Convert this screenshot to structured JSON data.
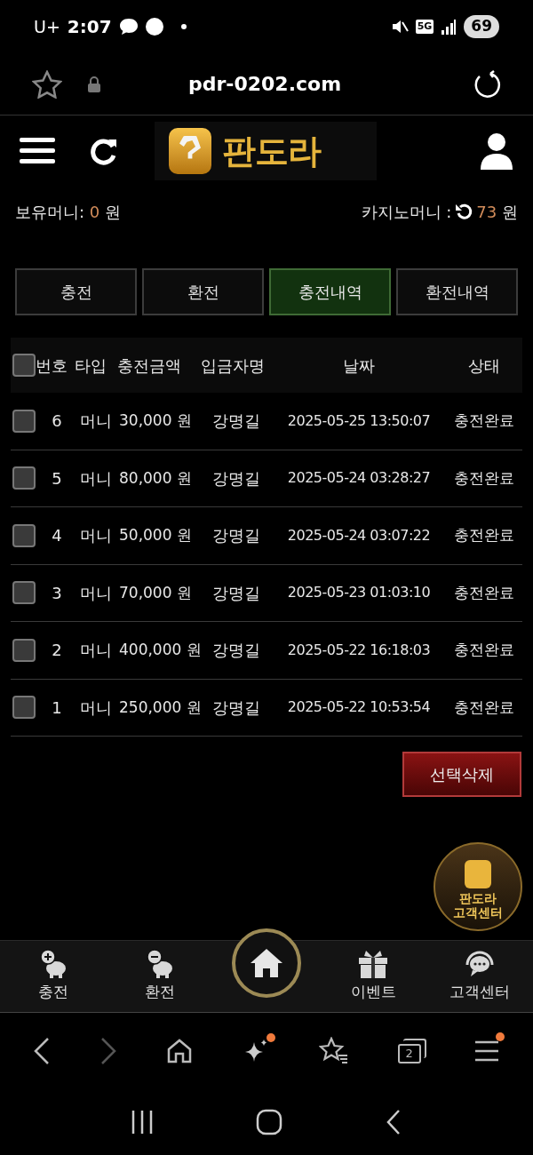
{
  "status_bar": {
    "carrier": "U+",
    "time": "2:07",
    "network": "5G",
    "battery": "69"
  },
  "browser": {
    "url": "pdr-0202.com"
  },
  "header": {
    "logo": "판도라"
  },
  "balances": {
    "held_label": "보유머니:",
    "held_value": "0",
    "held_unit": "원",
    "casino_label": "카지노머니 :",
    "casino_value": "73",
    "casino_unit": "원"
  },
  "tabs": [
    {
      "label": "충전",
      "selected": false
    },
    {
      "label": "환전",
      "selected": false
    },
    {
      "label": "충전내역",
      "selected": true
    },
    {
      "label": "환전내역",
      "selected": false
    }
  ],
  "table": {
    "select_all_checked": false,
    "columns": [
      "번호",
      "타입",
      "충전금액",
      "입금자명",
      "날짜",
      "상태"
    ],
    "rows": [
      {
        "checked": false,
        "cells": [
          "6",
          "머니",
          "30,000 원",
          "강명길",
          "2025-05-25 13:50:07",
          "충전완료"
        ]
      },
      {
        "checked": false,
        "cells": [
          "5",
          "머니",
          "80,000 원",
          "강명길",
          "2025-05-24 03:28:27",
          "충전완료"
        ]
      },
      {
        "checked": false,
        "cells": [
          "4",
          "머니",
          "50,000 원",
          "강명길",
          "2025-05-24 03:07:22",
          "충전완료"
        ]
      },
      {
        "checked": false,
        "cells": [
          "3",
          "머니",
          "70,000 원",
          "강명길",
          "2025-05-23 01:03:10",
          "충전완료"
        ]
      },
      {
        "checked": false,
        "cells": [
          "2",
          "머니",
          "400,000 원",
          "강명길",
          "2025-05-22 16:18:03",
          "충전완료"
        ]
      },
      {
        "checked": false,
        "cells": [
          "1",
          "머니",
          "250,000 원",
          "강명길",
          "2025-05-22 10:53:54",
          "충전완료"
        ]
      }
    ]
  },
  "delete_button": "선택삭제",
  "support_badge": {
    "line1": "판도라",
    "line2": "고객센터"
  },
  "bottom_nav": [
    {
      "kind": "deposit",
      "label": "충전"
    },
    {
      "kind": "withdraw",
      "label": "환전"
    },
    {
      "kind": "home"
    },
    {
      "kind": "event",
      "label": "이벤트"
    },
    {
      "kind": "support",
      "label": "고객센터"
    }
  ],
  "browser_toolbar": {
    "tab_count": "2"
  }
}
